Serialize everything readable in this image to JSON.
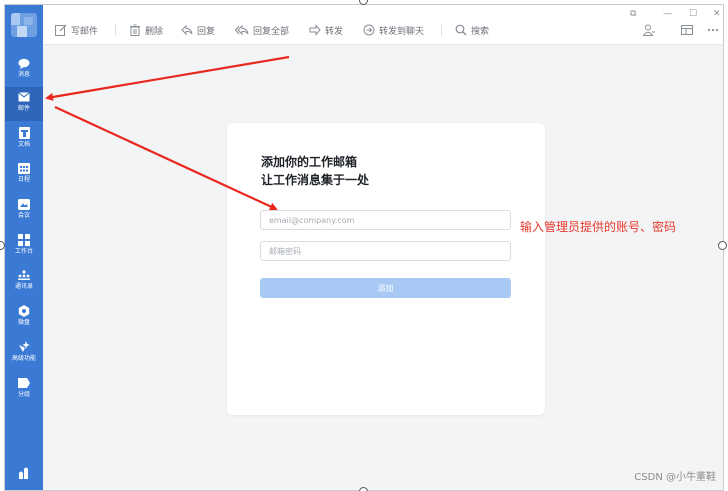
{
  "sidebar": {
    "items": [
      {
        "label": "消息",
        "icon": "chat-bubble-icon"
      },
      {
        "label": "邮件",
        "icon": "mail-icon"
      },
      {
        "label": "文档",
        "icon": "document-icon"
      },
      {
        "label": "日程",
        "icon": "calendar-icon"
      },
      {
        "label": "会议",
        "icon": "meeting-icon"
      },
      {
        "label": "工作台",
        "icon": "workbench-icon"
      },
      {
        "label": "通讯录",
        "icon": "contacts-icon"
      },
      {
        "label": "微盘",
        "icon": "drive-icon"
      },
      {
        "label": "高级功能",
        "icon": "advanced-icon"
      },
      {
        "label": "分组",
        "icon": "group-icon"
      }
    ]
  },
  "toolbar": {
    "compose": "写邮件",
    "delete": "删除",
    "reply": "回复",
    "reply_all": "回复全部",
    "forward": "转发",
    "forward_chat": "转发到聊天",
    "search": "搜索"
  },
  "card": {
    "title_line1": "添加你的工作邮箱",
    "title_line2": "让工作消息集于一处",
    "email_placeholder": "email@company.com",
    "password_placeholder": "邮箱密码",
    "add_label": "添加"
  },
  "annotation": "输入管理员提供的账号、密码",
  "watermark": "CSDN @小牛董鞋",
  "colors": {
    "sidebar": "#3a79d4",
    "accent_button": "#a9c9f5",
    "annotation": "#e8382e"
  }
}
